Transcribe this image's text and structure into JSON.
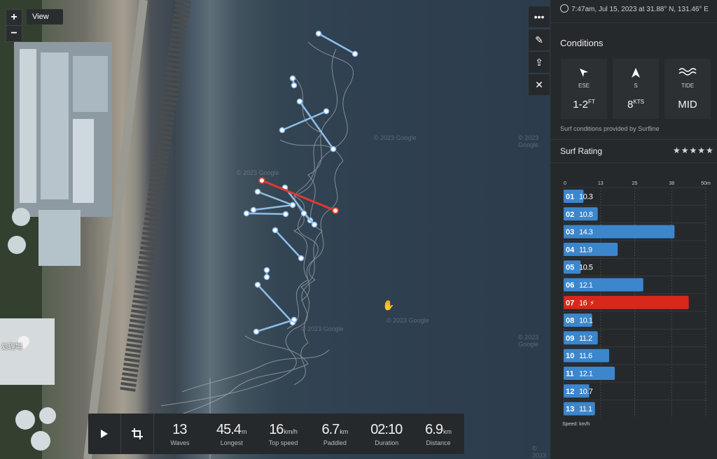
{
  "map": {
    "view_label": "View",
    "zoom_in": "+",
    "zoom_out": "−",
    "watermark": "© 2023 Google",
    "poi_label": "処理場",
    "tools": [
      "more-icon",
      "edit-icon",
      "share-icon",
      "close-icon"
    ]
  },
  "session_stats": [
    {
      "value": "13",
      "unit": "",
      "label": "Waves"
    },
    {
      "value": "45.4",
      "unit": "m",
      "label": "Longest"
    },
    {
      "value": "16",
      "unit": "km/h",
      "label": "Top speed"
    },
    {
      "value": "6.7",
      "unit": "km",
      "label": "Paddled"
    },
    {
      "value": "02:10",
      "unit": "",
      "label": "Duration"
    },
    {
      "value": "6.9",
      "unit": "km",
      "label": "Distance"
    }
  ],
  "panel": {
    "location_text": "7:47am, Jul 15, 2023 at 31.88° N, 131.46° E",
    "conditions_title": "Conditions",
    "conditions": [
      {
        "icon": "wind-direction-icon",
        "sub": "ESE",
        "value": "1-2",
        "unit": "FT"
      },
      {
        "icon": "swell-direction-icon",
        "sub": "S",
        "value": "8",
        "unit": "KTS"
      },
      {
        "icon": "tide-icon",
        "sub": "TIDE",
        "value": "MID",
        "unit": ""
      }
    ],
    "conditions_note": "Surf conditions provided by Surfline",
    "rating_title": "Surf Rating",
    "stars": "★★★★★"
  },
  "colors": {
    "bar": "#3b86cc",
    "highlight": "#d7281b",
    "track": "#8fbde8",
    "track_highlight": "#e03a2c"
  },
  "chart_data": {
    "type": "bar",
    "axis_ticks": [
      "0",
      "13",
      "25",
      "38",
      "50m"
    ],
    "xlim": [
      0,
      50
    ],
    "unit_note": "Speed: km/h",
    "highlight_index": 6,
    "waves": [
      {
        "id": "01",
        "speed": "10.3",
        "length": 7
      },
      {
        "id": "02",
        "speed": "10.8",
        "length": 12
      },
      {
        "id": "03",
        "speed": "14.3",
        "length": 39
      },
      {
        "id": "04",
        "speed": "11.9",
        "length": 19
      },
      {
        "id": "05",
        "speed": "10.5",
        "length": 6
      },
      {
        "id": "06",
        "speed": "12.1",
        "length": 28
      },
      {
        "id": "07",
        "speed": "16",
        "length": 44
      },
      {
        "id": "08",
        "speed": "10.1",
        "length": 10
      },
      {
        "id": "09",
        "speed": "11.2",
        "length": 12
      },
      {
        "id": "10",
        "speed": "11.6",
        "length": 16
      },
      {
        "id": "11",
        "speed": "12.1",
        "length": 18
      },
      {
        "id": "12",
        "speed": "10.7",
        "length": 9
      },
      {
        "id": "13",
        "speed": "11.1",
        "length": 11
      }
    ]
  }
}
